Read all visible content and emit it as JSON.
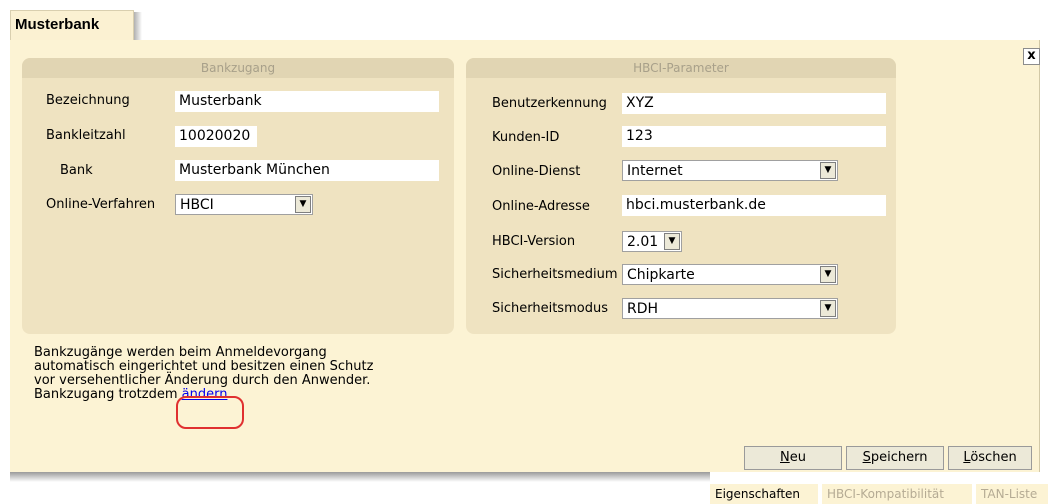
{
  "window": {
    "tab_title": "Musterbank",
    "close_symbol": "x",
    "close_icon": "close-icon"
  },
  "bankzugang": {
    "title": "Bankzugang",
    "bezeichnung_label": "Bezeichnung",
    "bezeichnung_value": "Musterbank",
    "blz_label": "Bankleitzahl",
    "blz_value": "10020020",
    "bank_label": "Bank",
    "bank_value": "Musterbank München",
    "verfahren_label": "Online-Verfahren",
    "verfahren_value": "HBCI"
  },
  "hbci": {
    "title": "HBCI-Parameter",
    "benutzer_label": "Benutzerkennung",
    "benutzer_value": "XYZ",
    "kunden_label": "Kunden-ID",
    "kunden_value": "123",
    "dienst_label": "Online-Dienst",
    "dienst_value": "Internet",
    "adresse_label": "Online-Adresse",
    "adresse_value": "hbci.musterbank.de",
    "version_label": "HBCI-Version",
    "version_value": "2.01",
    "medium_label": "Sicherheitsmedium",
    "medium_value": "Chipkarte",
    "modus_label": "Sicherheitsmodus",
    "modus_value": "RDH"
  },
  "info": {
    "line1": "Bankzugänge werden beim Anmeldevorgang",
    "line2": "automatisch eingerichtet und besitzen einen Schutz",
    "line3": "vor versehentlicher Änderung durch den Anwender.",
    "line4_prefix": "Bankzugang trotzdem ",
    "link": "ändern",
    "line4_suffix": "."
  },
  "buttons": {
    "neu_acc": "N",
    "neu_rest": "eu",
    "speichern_acc": "S",
    "speichern_rest": "peichern",
    "loeschen_acc": "L",
    "loeschen_rest": "öschen"
  },
  "bottom_tabs": [
    {
      "label": "Eigenschaften",
      "active": true
    },
    {
      "label": "HBCI-Kompatibilität",
      "active": false
    },
    {
      "label": "TAN-Liste",
      "active": false
    }
  ],
  "arrow_glyph": "▼",
  "colors": {
    "panel": "#fcf3d4",
    "group": "#efe3c1",
    "group_title": "#e1d5b3",
    "highlight": "#e03030",
    "link": "#0000ee"
  }
}
